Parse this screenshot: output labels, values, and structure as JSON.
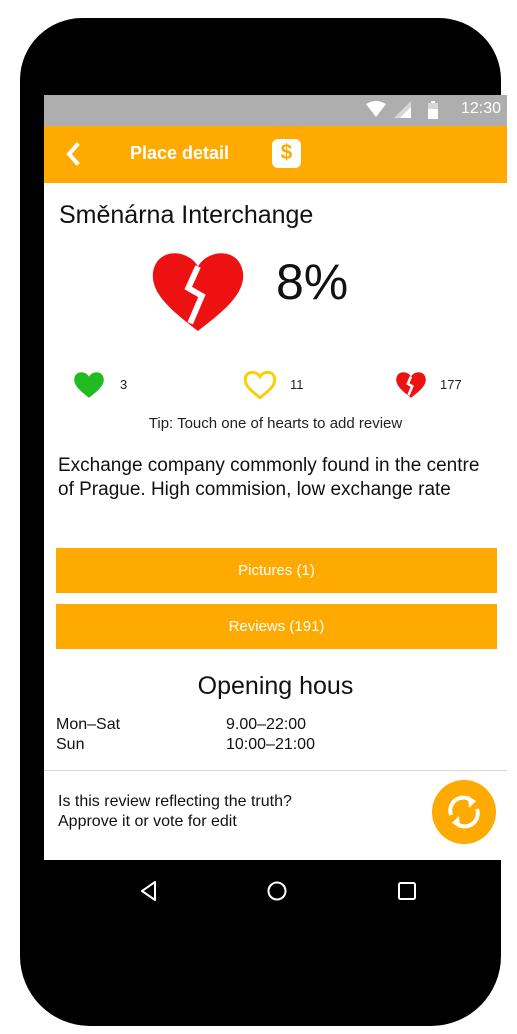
{
  "status_bar": {
    "time": "12:30"
  },
  "app_bar": {
    "title": "Place detail",
    "action_symbol": "$"
  },
  "place": {
    "name": "Směnárna Interchange",
    "score": "8%",
    "description": "Exchange company commonly found in the centre of Prague. High commision, low exchange rate"
  },
  "reviews": {
    "positive_count": "3",
    "neutral_count": "11",
    "negative_count": "177",
    "tip": "Tip: Touch one of hearts to add review"
  },
  "buttons": {
    "pictures": "Pictures (1)",
    "reviews": "Reviews (191)"
  },
  "opening_hours": {
    "title": "Opening hous",
    "rows": [
      {
        "days": "Mon–Sat",
        "time": "9.00–22:00"
      },
      {
        "days": "Sun",
        "time": "10:00–21:00"
      }
    ]
  },
  "verification": {
    "line1": "Is this review reflecting the truth?",
    "line2": "Approve it or vote for edit"
  },
  "colors": {
    "accent": "#ffaa00",
    "heart_positive": "#22bb22",
    "heart_negative": "#ee1111",
    "status_bar": "#aeaeae"
  },
  "icons": [
    "back-arrow-icon",
    "dollar-icon",
    "broken-heart-icon",
    "green-heart-icon",
    "outline-heart-icon",
    "refresh-icon",
    "nav-back-icon",
    "nav-home-icon",
    "nav-recents-icon",
    "wifi-icon",
    "signal-icon",
    "battery-icon"
  ]
}
